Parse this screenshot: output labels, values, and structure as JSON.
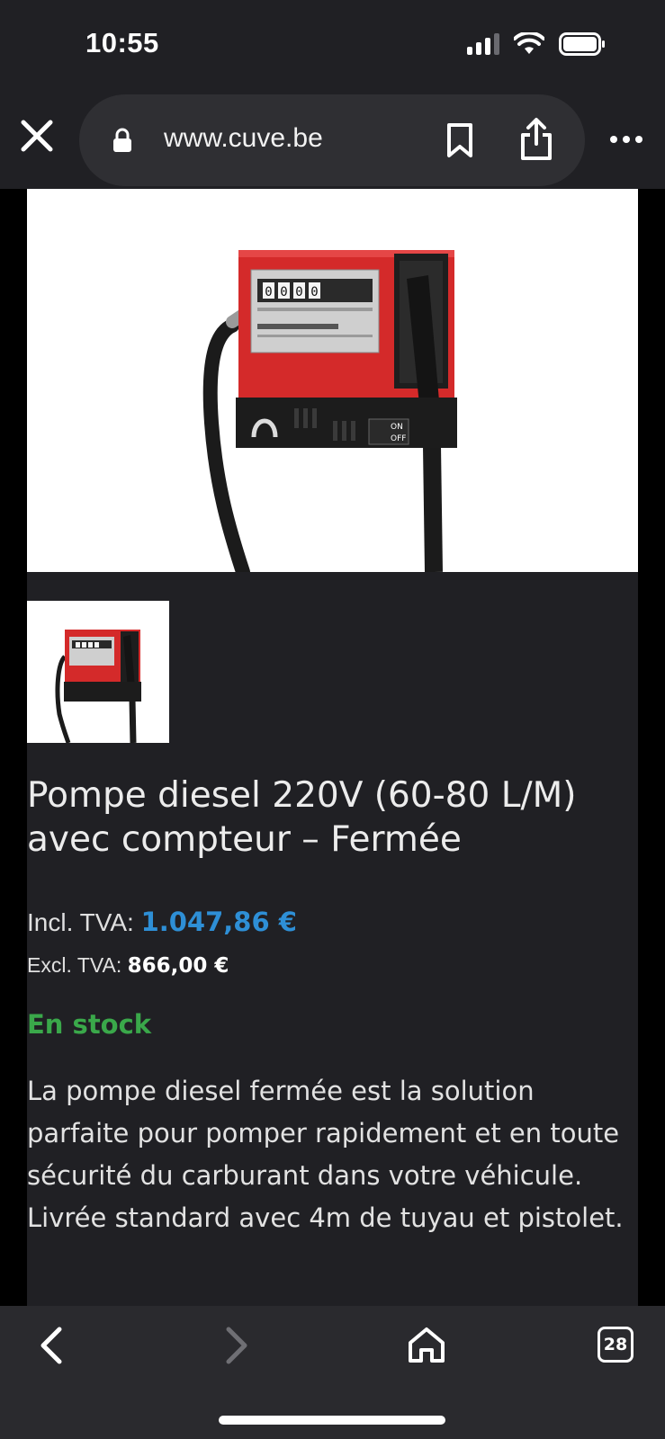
{
  "status_bar": {
    "time": "10:55",
    "icons": [
      "signal-icon",
      "wifi-icon",
      "battery-icon"
    ]
  },
  "browser": {
    "url": "www.cuve.be",
    "icons": [
      "close-icon",
      "lock-icon",
      "bookmark-icon",
      "share-icon",
      "more-icon"
    ]
  },
  "product": {
    "title": "Pompe diesel 220V (60-80 L/M) avec compteur – Fermée",
    "price_incl_label": "Incl. TVA:",
    "price_incl_value": "1.047,86 €",
    "price_excl_label": "Excl. TVA:",
    "price_excl_value": "866,00 €",
    "stock": "En stock",
    "description": "La pompe diesel fermée est la solution parfaite pour pomper rapidement et en toute sécurité du carburant dans votre véhicule. Livrée standard avec 4m de tuyau et pistolet.",
    "image": {
      "counter_digits": "0000",
      "switch_on": "ON",
      "switch_off": "OFF"
    }
  },
  "bottom_nav": {
    "tab_count": "28",
    "icons": [
      "back-icon",
      "forward-icon",
      "home-icon",
      "tabs-icon"
    ]
  },
  "colors": {
    "background": "#202024",
    "price_accent": "#2e8fd6",
    "stock_green": "#3aa84a",
    "pump_red": "#d42a2a"
  }
}
